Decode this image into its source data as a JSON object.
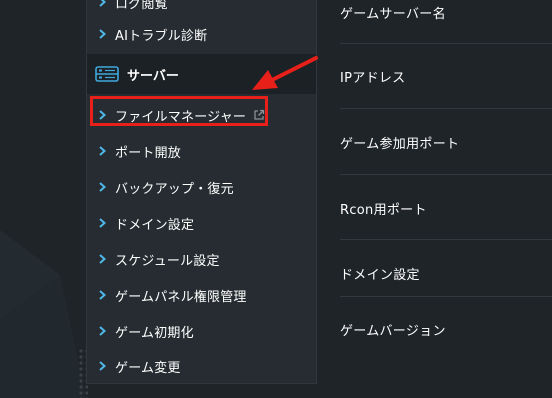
{
  "menu": {
    "items_top": [
      {
        "label": "ログ閲覧"
      },
      {
        "label": "AIトラブル診断"
      }
    ],
    "section": {
      "label": "サーバー",
      "icon": "server-panel-icon"
    },
    "items": [
      {
        "label": "ファイルマネージャー",
        "external": true
      },
      {
        "label": "ポート開放"
      },
      {
        "label": "バックアップ・復元"
      },
      {
        "label": "ドメイン設定"
      },
      {
        "label": "スケジュール設定"
      },
      {
        "label": "ゲームパネル権限管理"
      },
      {
        "label": "ゲーム初期化"
      },
      {
        "label": "ゲーム変更"
      }
    ]
  },
  "settings": {
    "rows": [
      {
        "label": "ゲームサーバー名"
      },
      {
        "label": "IPアドレス"
      },
      {
        "label": "ゲーム参加用ポート"
      },
      {
        "label": "Rcon用ポート"
      },
      {
        "label": "ドメイン設定"
      },
      {
        "label": "ゲームバージョン"
      }
    ]
  },
  "colors": {
    "background": "#1f2429",
    "menu_panel": "#262c31",
    "section_header": "#1c2126",
    "chevron": "#4fb8e8",
    "accent_icon": "#3fa7dc",
    "highlight": "#e8201a",
    "text": "#ffffff"
  }
}
